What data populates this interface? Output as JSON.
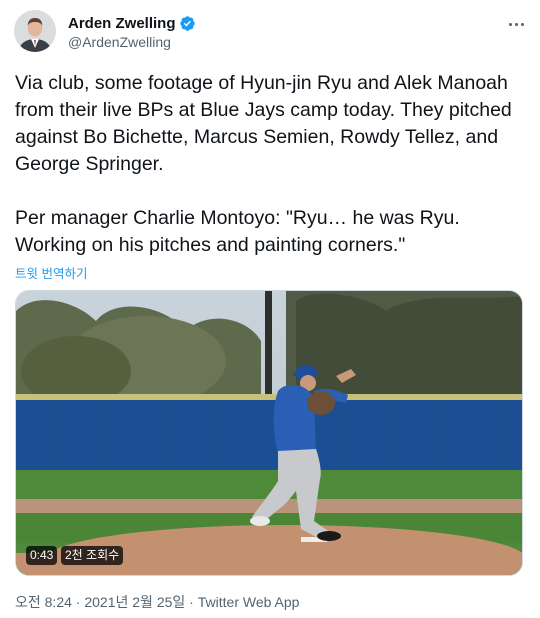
{
  "author": {
    "display_name": "Arden Zwelling",
    "handle": "@ArdenZwelling",
    "verified_icon": "verified-badge-icon",
    "accent_color": "#1d9bf0"
  },
  "tweet": {
    "text": "Via club, some footage of Hyun-jin Ryu and Alek Manoah from their live BPs at Blue Jays camp today. They pitched against Bo Bichette, Marcus Semien, Rowdy Tellez, and George Springer.\n\nPer manager Charlie Montoyo: \"Ryu… he was Ryu. Working on his pitches and painting corners.\"",
    "translate_label": "트윗 번역하기"
  },
  "video": {
    "duration": "0:43",
    "views": "2천 조회수"
  },
  "meta": {
    "time": "오전 8:24",
    "separator": " · ",
    "date": "2021년 2월 25일",
    "source": "Twitter Web App"
  }
}
